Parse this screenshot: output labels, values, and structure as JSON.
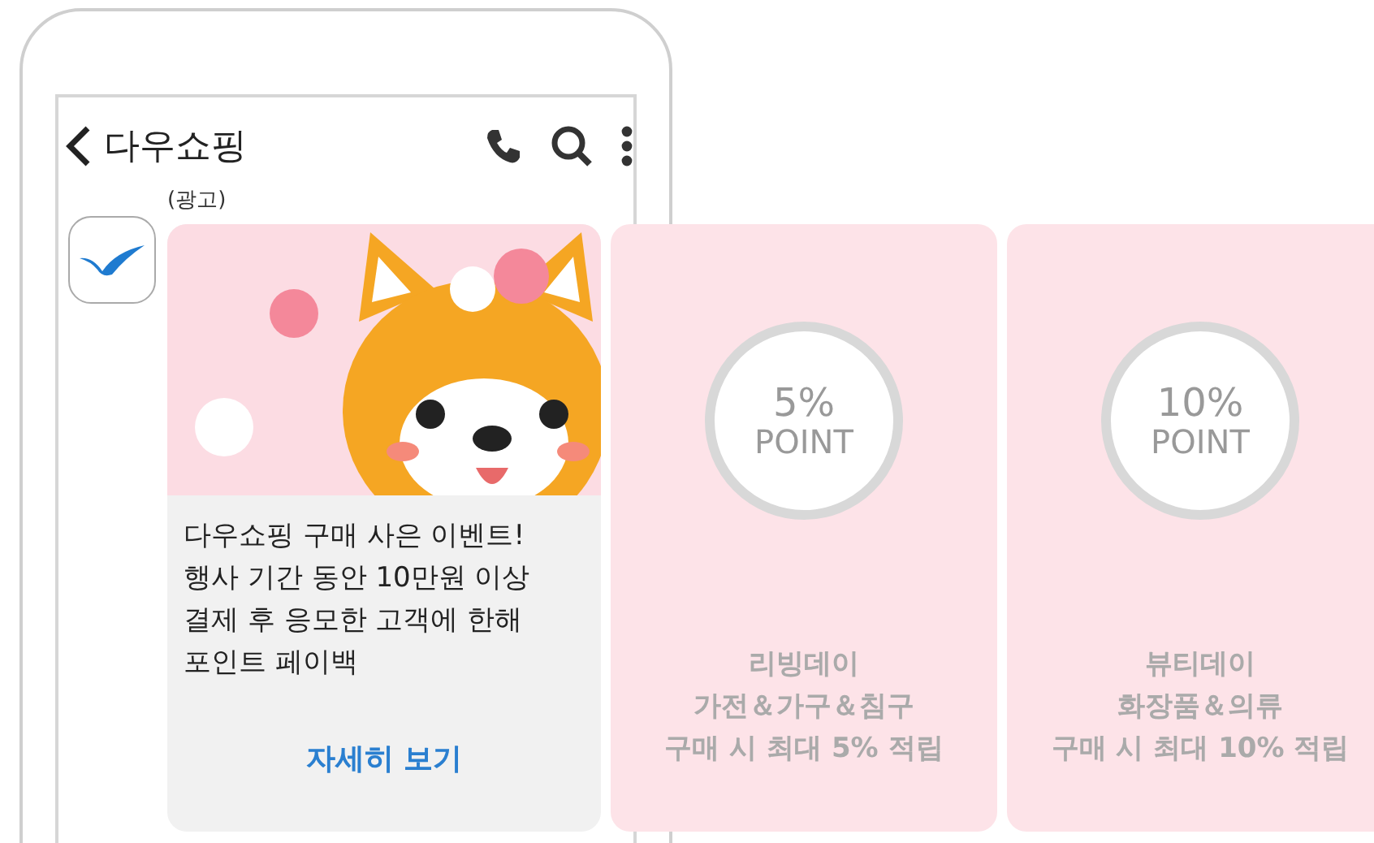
{
  "header": {
    "title": "다우쇼핑"
  },
  "ad_label": "(광고)",
  "cards": [
    {
      "kind": "message",
      "lines": [
        "다우쇼핑 구매 사은 이벤트!",
        "행사 기간 동안 10만원 이상",
        "결제 후 응모한 고객에 한해",
        "포인트 페이백"
      ],
      "link": "자세히 보기"
    },
    {
      "kind": "point",
      "percent": "5%",
      "unit": "POINT",
      "lines": [
        "리빙데이",
        "가전＆가구＆침구",
        "구매 시 최대 5% 적립"
      ]
    },
    {
      "kind": "point",
      "percent": "10%",
      "unit": "POINT",
      "lines": [
        "뷰티데이",
        "화장품＆의류",
        "구매 시 최대 10% 적립"
      ]
    }
  ]
}
